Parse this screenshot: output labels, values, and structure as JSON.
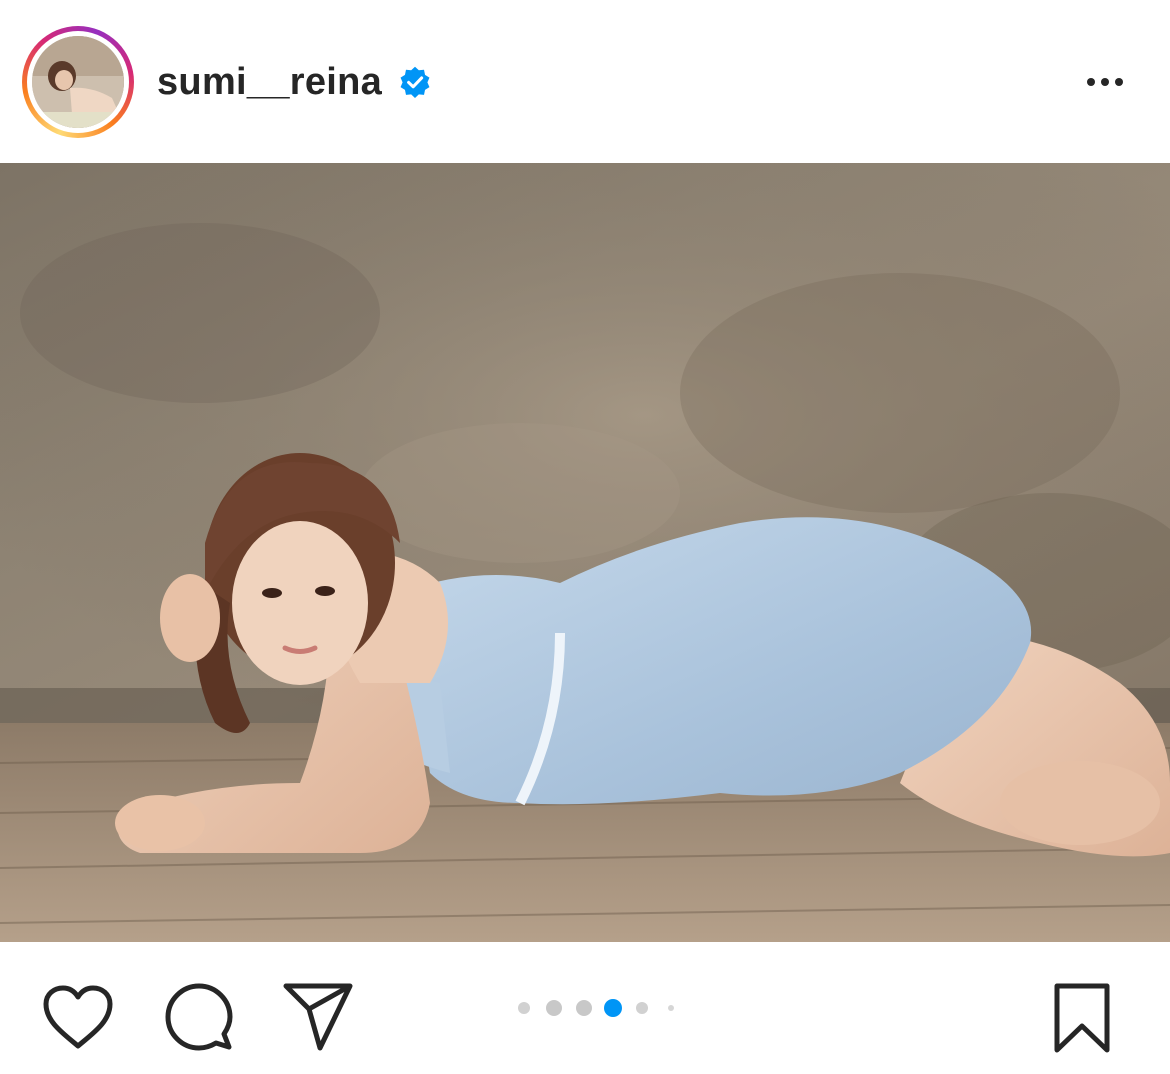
{
  "header": {
    "username": "sumi__reina",
    "verified": true,
    "verified_icon": "verified-badge-icon",
    "more_icon": "more-options-icon",
    "avatar_ring_colors": [
      "#feda75",
      "#fa7e1e",
      "#d62976",
      "#962fbf"
    ]
  },
  "post": {
    "media_type": "photo",
    "carousel": {
      "total_dots_visible": 6,
      "active_index": 4
    }
  },
  "actions": {
    "like_icon": "heart-icon",
    "comment_icon": "comment-icon",
    "share_icon": "paper-plane-icon",
    "save_icon": "bookmark-icon"
  },
  "colors": {
    "text": "#262626",
    "verified_blue": "#0095f6",
    "active_dot": "#0095f6",
    "inactive_dot": "#c8c8c8"
  }
}
